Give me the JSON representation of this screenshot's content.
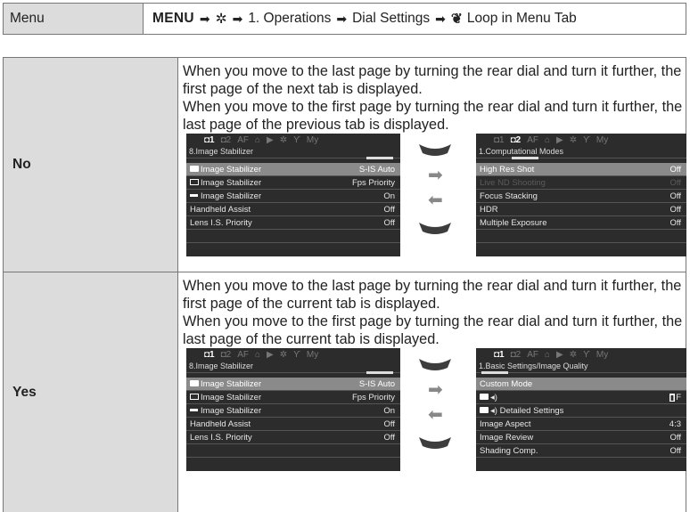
{
  "menu": {
    "label": "Menu",
    "path_menu": "MENU",
    "path_step1": "1. Operations",
    "path_step2": "Dial Settings",
    "path_step3": "Loop in Menu Tab",
    "arrow_glyph": "➡",
    "gear_glyph": "✲",
    "wrench_glyph": "✔"
  },
  "rows": [
    {
      "label": "No",
      "text1": "When you move to the last page by turning the rear dial and turn it further, the first page of the next tab is displayed.",
      "text2": "When you move to the first page by turning the rear dial and turn it further, the last page of the previous tab is displayed.",
      "left_screen": {
        "tabs": [
          "1",
          "2",
          "AF",
          "",
          "",
          "",
          "",
          "My"
        ],
        "title": "8.Image Stabilizer",
        "items": [
          {
            "label": "Image Stabilizer",
            "value": "S-IS Auto",
            "icon": "camera"
          },
          {
            "label": "Image Stabilizer",
            "value": "Fps Priority",
            "icon": "monitor"
          },
          {
            "label": "Image Stabilizer",
            "value": "On",
            "icon": "line"
          },
          {
            "label": "Handheld Assist",
            "value": "Off",
            "icon": ""
          },
          {
            "label": "Lens I.S. Priority",
            "value": "Off",
            "icon": ""
          }
        ]
      },
      "right_screen": {
        "title": "1.Computational Modes",
        "items": [
          {
            "label": "High Res Shot",
            "value": "Off"
          },
          {
            "label": "Live ND Shooting",
            "value": "Off"
          },
          {
            "label": "Focus Stacking",
            "value": "Off"
          },
          {
            "label": "HDR",
            "value": "Off"
          },
          {
            "label": "Multiple Exposure",
            "value": "Off"
          }
        ]
      }
    },
    {
      "label": "Yes",
      "text1": "When you move to the last page by turning the rear dial and turn it further, the first page of the current tab is displayed.",
      "text2": "When you move to the first page by turning the rear dial and turn it further, the last page of the current tab is displayed.",
      "left_screen": {
        "title": "8.Image Stabilizer",
        "items": [
          {
            "label": "Image Stabilizer",
            "value": "S-IS Auto"
          },
          {
            "label": "Image Stabilizer",
            "value": "Fps Priority"
          },
          {
            "label": "Image Stabilizer",
            "value": "On"
          },
          {
            "label": "Handheld Assist",
            "value": "Off"
          },
          {
            "label": "Lens I.S. Priority",
            "value": "Off"
          }
        ]
      },
      "right_screen": {
        "title": "1.Basic Settings/Image Quality",
        "items": [
          {
            "label": "Custom Mode",
            "value": ""
          },
          {
            "label": "",
            "value": "F"
          },
          {
            "label": "Detailed Settings",
            "value": ""
          },
          {
            "label": "Image Aspect",
            "value": "4:3"
          },
          {
            "label": "Image Review",
            "value": "Off"
          },
          {
            "label": "Shading Comp.",
            "value": "Off"
          }
        ]
      }
    }
  ],
  "tab_labels": {
    "af": "AF",
    "my": "My"
  }
}
